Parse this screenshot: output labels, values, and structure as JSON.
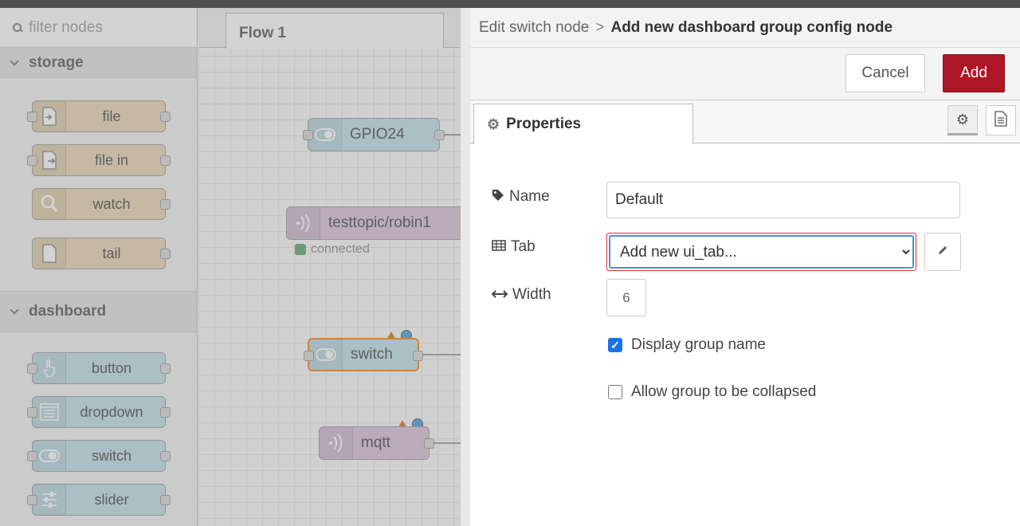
{
  "palette": {
    "search_placeholder": "filter nodes",
    "categories": [
      {
        "name": "storage",
        "nodes": [
          {
            "label": "file",
            "icon": "file-icon"
          },
          {
            "label": "file in",
            "icon": "file-in-icon"
          },
          {
            "label": "watch",
            "icon": "watch-icon"
          },
          {
            "label": "tail",
            "icon": "tail-icon"
          }
        ]
      },
      {
        "name": "dashboard",
        "nodes": [
          {
            "label": "button",
            "icon": "hand-pointer-icon"
          },
          {
            "label": "dropdown",
            "icon": "list-icon"
          },
          {
            "label": "switch",
            "icon": "toggle-icon"
          },
          {
            "label": "slider",
            "icon": "sliders-icon"
          }
        ]
      }
    ]
  },
  "workspace": {
    "tab_label": "Flow 1",
    "nodes": [
      {
        "label": "GPIO24",
        "icon": "toggle-icon"
      },
      {
        "label": "testtopic/robin1",
        "icon": "wifi-icon",
        "status": "connected"
      },
      {
        "label": "switch",
        "icon": "toggle-icon"
      },
      {
        "label": "mqtt",
        "icon": "wifi-icon"
      }
    ]
  },
  "tray": {
    "breadcrumb_parent": "Edit switch node",
    "breadcrumb_sep": ">",
    "breadcrumb_current": "Add new dashboard group config node",
    "cancel_label": "Cancel",
    "add_label": "Add",
    "tab_properties": "Properties",
    "form": {
      "name_label": "Name",
      "name_value": "Default",
      "tab_label": "Tab",
      "tab_value": "Add new ui_tab...",
      "width_label": "Width",
      "width_value": "6",
      "display_group_name_label": "Display group name",
      "display_group_name_checked": true,
      "collapse_label": "Allow group to be collapsed",
      "collapse_checked": false
    }
  },
  "colors": {
    "add_button": "#ad1625",
    "storage_node": "#e8d6b2",
    "dashboard_node": "#bde0e8",
    "mqtt_node": "#d8bfd8",
    "checkbox_checked": "#1a73e8"
  }
}
